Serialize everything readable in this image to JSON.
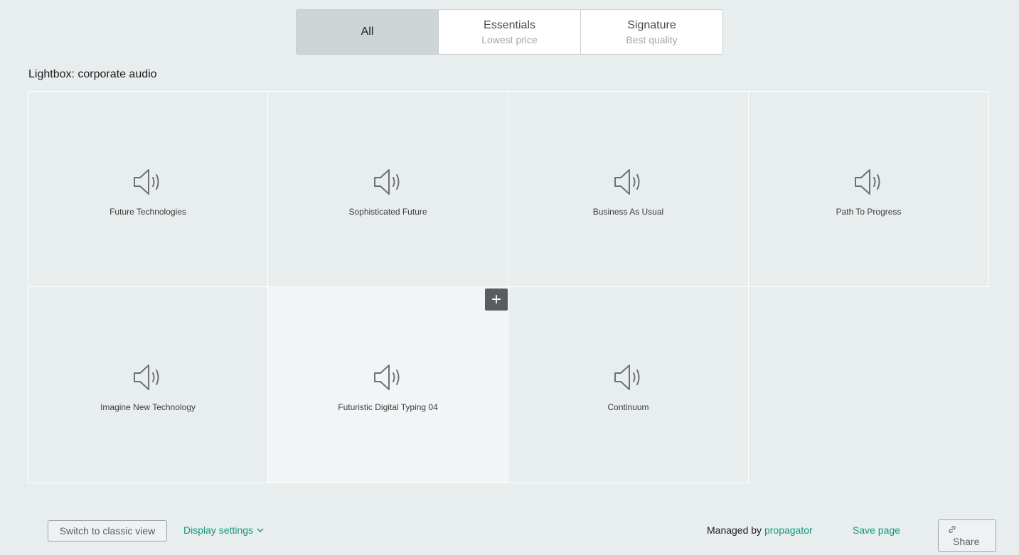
{
  "tabs": [
    {
      "label": "All",
      "sub": ""
    },
    {
      "label": "Essentials",
      "sub": "Lowest price"
    },
    {
      "label": "Signature",
      "sub": "Best quality"
    }
  ],
  "lightbox_title": "Lightbox: corporate audio",
  "tracks": [
    {
      "title": "Future Technologies",
      "icon": "speaker-icon"
    },
    {
      "title": "Sophisticated Future",
      "icon": "speaker-icon"
    },
    {
      "title": "Business As Usual",
      "icon": "speaker-icon"
    },
    {
      "title": "Path To Progress",
      "icon": "speaker-icon"
    },
    {
      "title": "Imagine New Technology",
      "icon": "speaker-icon"
    },
    {
      "title": "Futuristic Digital Typing 04",
      "icon": "speaker-icon"
    },
    {
      "title": "Continuum",
      "icon": "speaker-icon"
    }
  ],
  "add_button": "+",
  "footer": {
    "classic_view": "Switch to classic view",
    "display_settings": "Display settings",
    "managed_by": "Managed by",
    "manager": "propagator",
    "save_page": "Save page",
    "share": "Share"
  },
  "colors": {
    "accent": "#119a7c",
    "background": "#e8edee",
    "active_tab": "#cdd5d6"
  }
}
